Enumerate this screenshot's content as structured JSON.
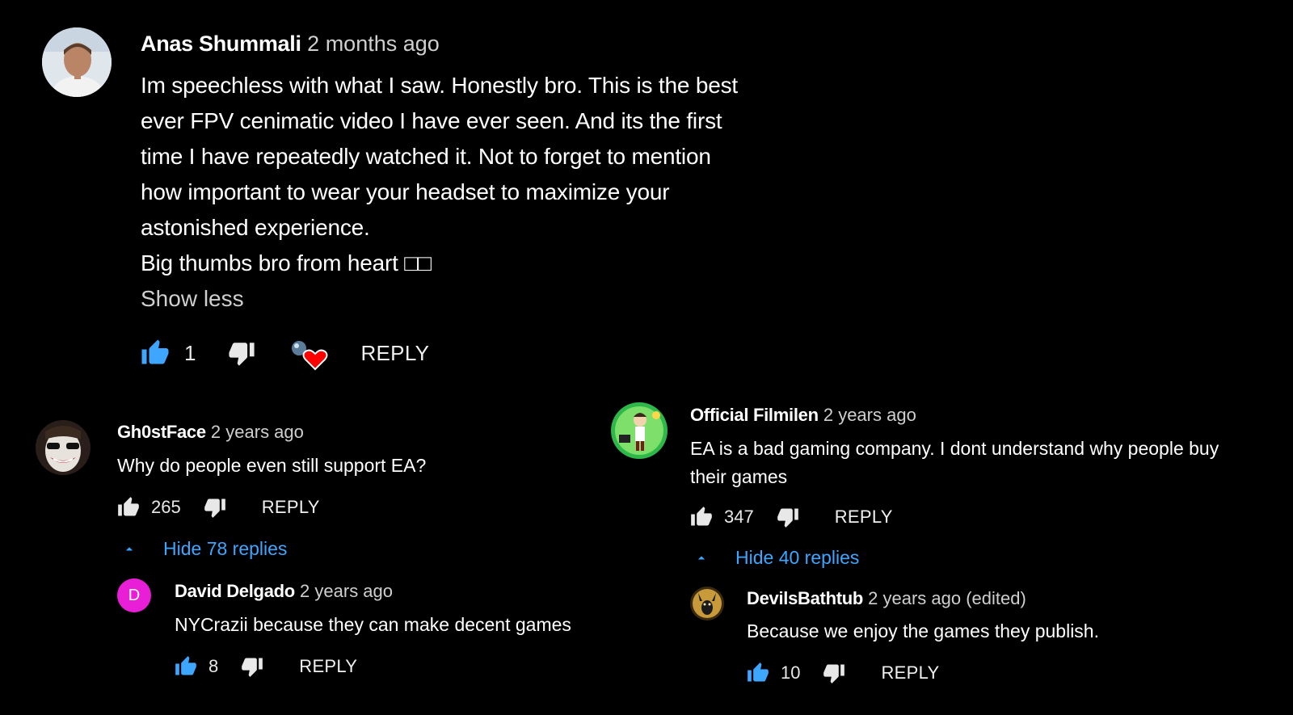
{
  "main_comment": {
    "author": "Anas Shummali",
    "time": "2 months ago",
    "lines": [
      "Im speechless with what I saw. Honestly bro. This is the best",
      "ever FPV cenimatic video I have ever seen. And its the first",
      "time I have repeatedly watched it. Not to forget to mention",
      "how important to wear your headset to maximize your",
      "astonished experience.",
      "Big thumbs bro from heart □□"
    ],
    "show_less": "Show less",
    "likes": "1",
    "reply": "REPLY"
  },
  "left_thread": {
    "comment": {
      "author": "Gh0stFace",
      "time": "2 years ago",
      "text": "Why do people even still support EA?",
      "likes": "265",
      "reply": "REPLY"
    },
    "toggle": "Hide 78 replies",
    "reply_comment": {
      "avatar_letter": "D",
      "author": "David Delgado",
      "time": "2 years ago",
      "text": "NYCrazii because they can make decent games",
      "likes": "8",
      "reply": "REPLY"
    }
  },
  "right_thread": {
    "comment": {
      "author": "Official Filmilen",
      "time": "2 years ago",
      "lines": [
        "EA is a bad gaming company. I dont understand why people buy",
        "their games"
      ],
      "likes": "347",
      "reply": "REPLY"
    },
    "toggle": "Hide 40 replies",
    "reply_comment": {
      "author": "DevilsBathtub",
      "time": "2 years ago (edited)",
      "text": "Because we enjoy the games they publish.",
      "likes": "10",
      "reply": "REPLY"
    }
  },
  "colors": {
    "accent_blue": "#3ea6ff",
    "heart_red": "#ff0000",
    "avatar_magenta": "#e91fd8"
  }
}
